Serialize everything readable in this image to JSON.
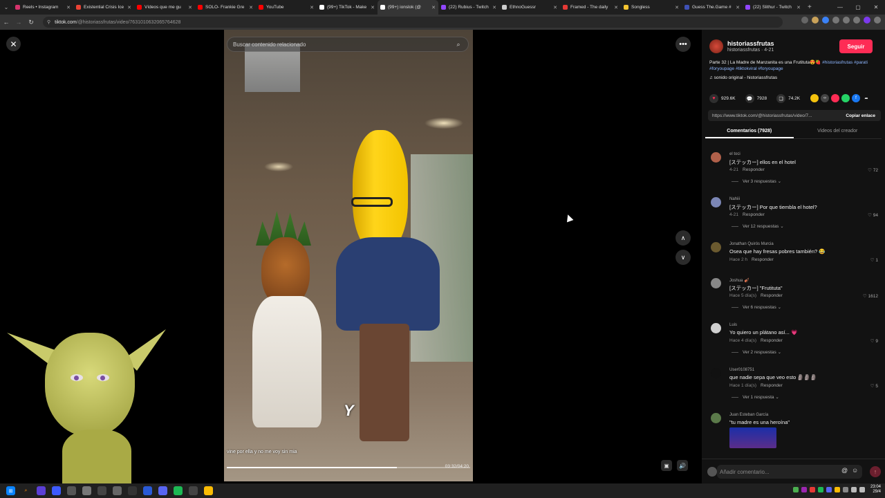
{
  "browser": {
    "tabs": [
      {
        "title": "Reels • Instagram",
        "color": "#d6336c",
        "active": false
      },
      {
        "title": "Existential Crisis Ice",
        "color": "#ea4335",
        "active": false
      },
      {
        "title": "Vídeos que me gu",
        "color": "#ff0000",
        "active": false
      },
      {
        "title": "SOLO- Frankie Gre",
        "color": "#ff0000",
        "active": false
      },
      {
        "title": "YouTube",
        "color": "#ff0000",
        "active": false
      },
      {
        "title": "(99+) TikTok - Make",
        "color": "#ffffff",
        "active": false
      },
      {
        "title": "(99+) ionslok (@",
        "color": "#ffffff",
        "active": true
      },
      {
        "title": "(22) Rubius - Twitch",
        "color": "#9146ff",
        "active": false
      },
      {
        "title": "EthnoGuessr",
        "color": "#cccccc",
        "active": false
      },
      {
        "title": "Framed - The daily",
        "color": "#e53935",
        "active": false
      },
      {
        "title": "Songless",
        "color": "#f4c430",
        "active": false
      },
      {
        "title": "Guess The.Game #",
        "color": "#3f51b5",
        "active": false
      },
      {
        "title": "(22) Slithur - Twitch",
        "color": "#9146ff",
        "active": false
      }
    ],
    "url_host": "tiktok.com",
    "url_path": "/@historiassfrutas/video/7631010632065764628"
  },
  "video": {
    "search_placeholder": "Buscar contenido relacionado",
    "subtitle": "vine por ella y no me voy sin mia",
    "caption_word": "Y",
    "timecode": "03:32/04:20",
    "progress": 0.7
  },
  "panel": {
    "author_name": "historiassfrutas",
    "author_sub": "historiassfrutas · 4-21",
    "follow_label": "Seguir",
    "desc_text": "Parte 32 | La Madre de Manzanita es una Frutituta😍🍓",
    "desc_tags_1": "#historiasfrutas",
    "desc_tags_2": "#parati #foryoupage #tiktokviral #foryoupage",
    "sound": "♫ sonido original - historiassfrutas",
    "likes": "929.6K",
    "comments_count": "7928",
    "saves": "74.2K",
    "link": "https://www.tiktok.com/@historiassfrutas/video/7...",
    "copy_label": "Copiar enlace",
    "tab_comments": "Comentarios (7928)",
    "tab_creator": "Videos del creador",
    "comment_placeholder": "Añadir comentario..."
  },
  "comments": [
    {
      "user": "el toci",
      "text": "[ステッカー] ellos en el hotel",
      "time": "4-21",
      "likes": "72",
      "replies": "Ver 3 respuestas",
      "avatar": "#b0604a"
    },
    {
      "user": "Nahiii",
      "text": "[ステッカー] Por que tiembla el hotel?",
      "time": "4-21",
      "likes": "94",
      "replies": "Ver 12 respuestas",
      "avatar": "#7b86b5"
    },
    {
      "user": "Jonathan Quirós Murcia",
      "text": "Osea que hay fresas pobres también? 😂",
      "time": "Hace 2 h",
      "likes": "1",
      "replies": "",
      "avatar": "#6b5a2f"
    },
    {
      "user": "Joshua 🎻",
      "text": "[ステッカー] \"Frutituta\"",
      "time": "Hace 5 día(s)",
      "likes": "1612",
      "replies": "Ver 6 respuestas",
      "avatar": "#888888"
    },
    {
      "user": "Luis",
      "text": "Yo quiero un plátano así... 💗",
      "time": "Hace 4 día(s)",
      "likes": "9",
      "replies": "Ver 2 respuestas",
      "avatar": "#cfcfcf"
    },
    {
      "user": "User0108751",
      "text": "que nadie sepa que veo esto 🗿🗿🗿",
      "time": "Hace 1 día(s)",
      "likes": "5",
      "replies": "Ver 1 respuesta",
      "avatar": "#111111"
    },
    {
      "user": "Juan Esteban García",
      "text": "\"tu madre es una heroína\"",
      "time": "",
      "likes": "",
      "replies": "",
      "avatar": "#5b7a4a"
    }
  ],
  "ui": {
    "reply_label": "Responder"
  },
  "taskbar": {
    "time": "23:04",
    "date": "29/4"
  }
}
